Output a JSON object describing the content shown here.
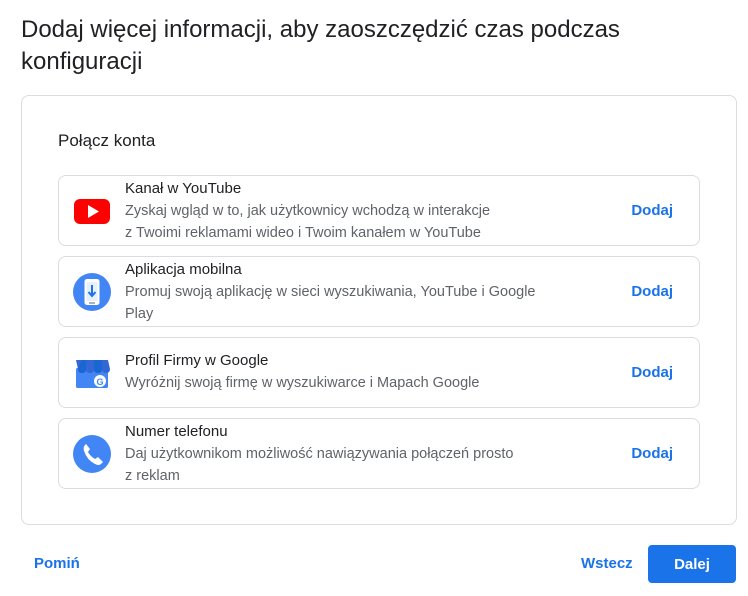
{
  "heading": "Dodaj więcej informacji, aby zaoszczędzić czas podczas konfiguracji",
  "card": {
    "title": "Połącz konta",
    "rows": [
      {
        "title": "Kanał w YouTube",
        "desc_line1": "Zyskaj wgląd w to, jak użytkownicy wchodzą w interakcje",
        "desc_line2": "z Twoimi reklamami wideo i Twoim kanałem w YouTube",
        "action": "Dodaj",
        "icon": "youtube-icon"
      },
      {
        "title": "Aplikacja mobilna",
        "desc_line1": "Promuj swoją aplikację w sieci wyszukiwania, YouTube i Google",
        "desc_line2": "Play",
        "action": "Dodaj",
        "icon": "mobile-app-icon"
      },
      {
        "title": "Profil Firmy w Google",
        "desc_line1": "Wyróżnij swoją firmę w wyszukiwarce i Mapach Google",
        "action": "Dodaj",
        "icon": "google-business-profile-icon"
      },
      {
        "title": "Numer telefonu",
        "desc_line1": "Daj użytkownikom możliwość nawiązywania połączeń prosto",
        "desc_line2": "z reklam",
        "action": "Dodaj",
        "icon": "phone-icon"
      }
    ]
  },
  "footer": {
    "skip": "Pomiń",
    "back": "Wstecz",
    "next": "Dalej"
  },
  "colors": {
    "accent": "#1a73e8",
    "youtube_red": "#ff0000",
    "border": "#dadce0",
    "text_secondary": "#5f6368"
  }
}
